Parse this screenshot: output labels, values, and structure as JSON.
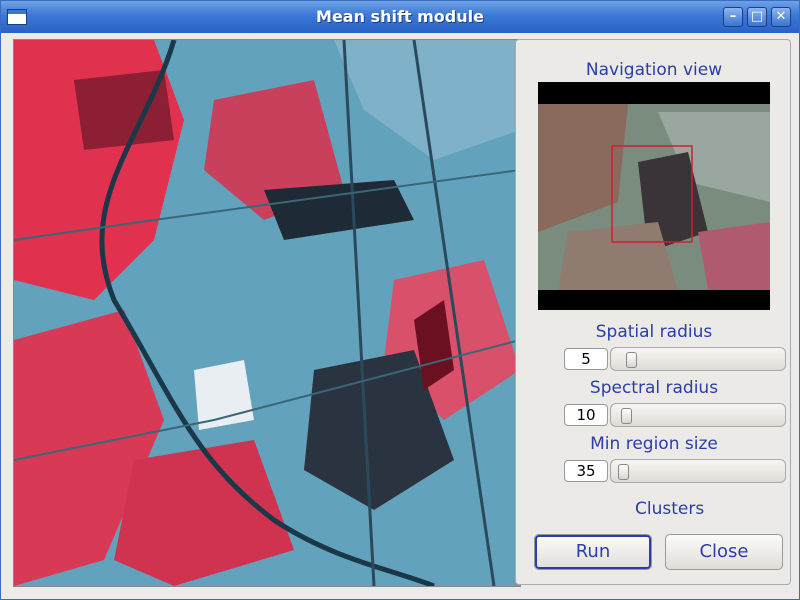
{
  "window": {
    "title": "Mean shift module"
  },
  "panel": {
    "navigation_label": "Navigation view",
    "spatial": {
      "label": "Spatial radius",
      "value": "5",
      "slider_fraction": 0.07
    },
    "spectral": {
      "label": "Spectral radius",
      "value": "10",
      "slider_fraction": 0.04
    },
    "minregion": {
      "label": "Min region size",
      "value": "35",
      "slider_fraction": 0.02
    },
    "clusters_label": "Clusters",
    "run_label": "Run",
    "close_label": "Close"
  },
  "colors": {
    "title_bar": "#3a78d6",
    "label_text": "#2a3da8",
    "imagery_red": "#e0324f",
    "imagery_cyan": "#66a0b8"
  }
}
